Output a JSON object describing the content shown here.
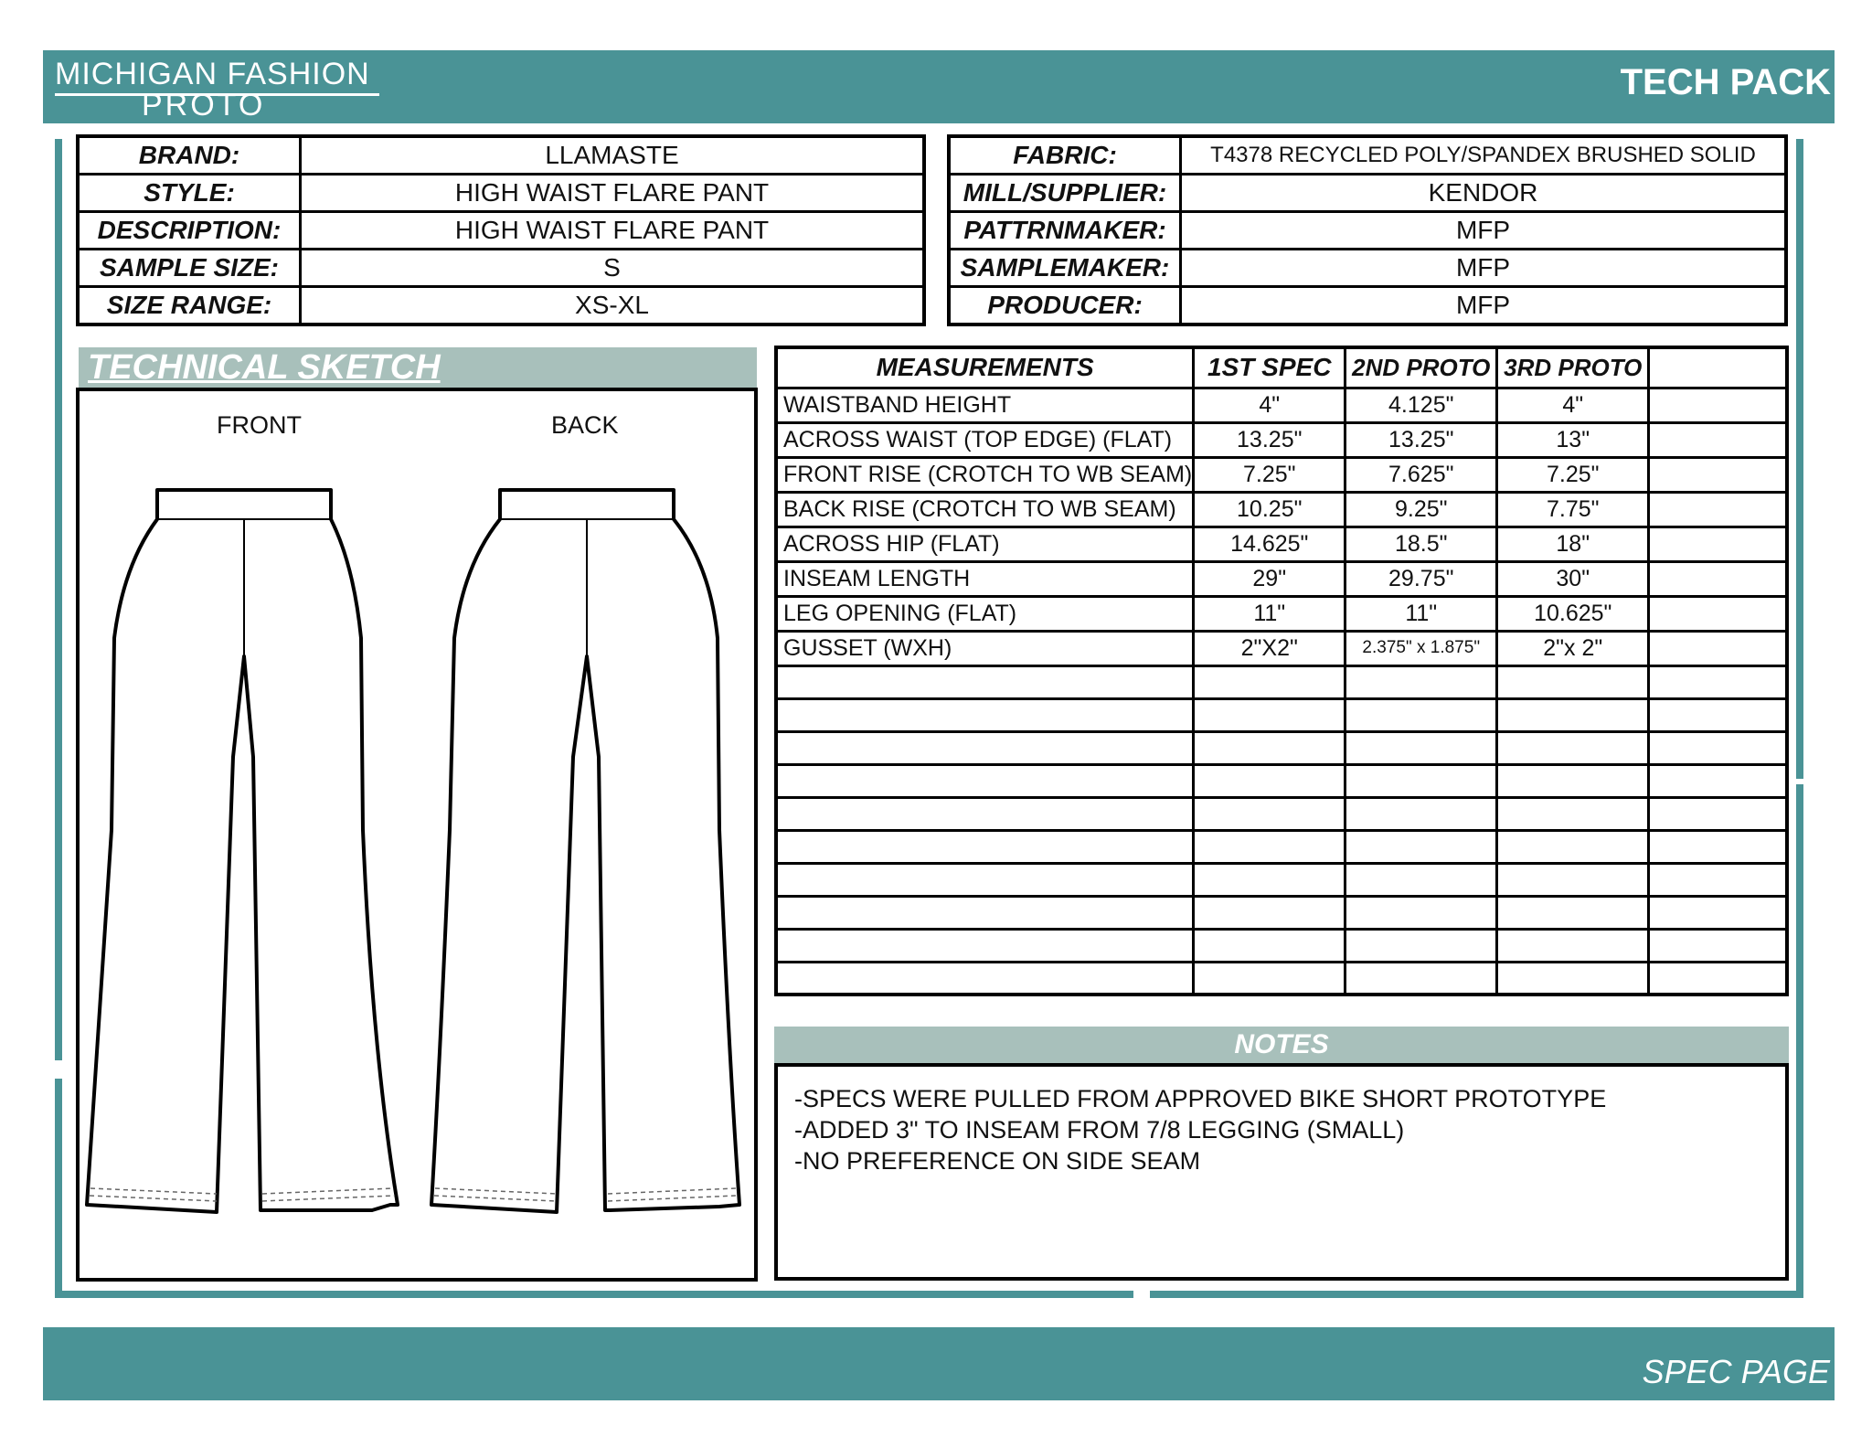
{
  "header": {
    "logo_line1": "MICHIGAN FASHION",
    "logo_line2": "PROTO",
    "title": "TECH PACK"
  },
  "footer": {
    "label": "SPEC PAGE"
  },
  "info_left": [
    {
      "label": "BRAND:",
      "value": "LLAMASTE"
    },
    {
      "label": "STYLE:",
      "value": "HIGH WAIST FLARE PANT"
    },
    {
      "label": "DESCRIPTION:",
      "value": "HIGH WAIST FLARE PANT"
    },
    {
      "label": "SAMPLE SIZE:",
      "value": "S"
    },
    {
      "label": "SIZE RANGE:",
      "value": "XS-XL"
    }
  ],
  "info_right": [
    {
      "label": "FABRIC:",
      "value": "T4378 RECYCLED POLY/SPANDEX BRUSHED SOLID"
    },
    {
      "label": "MILL/SUPPLIER:",
      "value": "KENDOR"
    },
    {
      "label": "PATTRNMAKER:",
      "value": "MFP"
    },
    {
      "label": "SAMPLEMAKER:",
      "value": "MFP"
    },
    {
      "label": "PRODUCER:",
      "value": "MFP"
    }
  ],
  "sketch": {
    "title": "TECHNICAL SKETCH",
    "front_label": "FRONT",
    "back_label": "BACK"
  },
  "measurements": {
    "headers": [
      "MEASUREMENTS",
      "1ST SPEC",
      "2ND PROTO",
      "3RD PROTO",
      ""
    ],
    "rows": [
      [
        "WAISTBAND HEIGHT",
        "4\"",
        "4.125\"",
        "4\"",
        ""
      ],
      [
        "ACROSS WAIST (TOP EDGE) (FLAT)",
        "13.25\"",
        "13.25\"",
        "13\"",
        ""
      ],
      [
        "FRONT RISE (CROTCH TO WB SEAM)",
        "7.25\"",
        "7.625\"",
        "7.25\"",
        ""
      ],
      [
        "BACK RISE (CROTCH TO WB SEAM)",
        "10.25\"",
        "9.25\"",
        "7.75\"",
        ""
      ],
      [
        "ACROSS HIP (FLAT)",
        "14.625\"",
        "18.5\"",
        "18\"",
        ""
      ],
      [
        "INSEAM LENGTH",
        "29\"",
        "29.75\"",
        "30\"",
        ""
      ],
      [
        "LEG OPENING (FLAT)",
        "11\"",
        "11\"",
        "10.625\"",
        ""
      ],
      [
        "GUSSET (WXH)",
        "2\"X2\"",
        "2.375\" x 1.875\"",
        "2\"x 2\"",
        ""
      ],
      [
        "",
        "",
        "",
        "",
        ""
      ],
      [
        "",
        "",
        "",
        "",
        ""
      ],
      [
        "",
        "",
        "",
        "",
        ""
      ],
      [
        "",
        "",
        "",
        "",
        ""
      ],
      [
        "",
        "",
        "",
        "",
        ""
      ],
      [
        "",
        "",
        "",
        "",
        ""
      ],
      [
        "",
        "",
        "",
        "",
        ""
      ],
      [
        "",
        "",
        "",
        "",
        ""
      ],
      [
        "",
        "",
        "",
        "",
        ""
      ],
      [
        "",
        "",
        "",
        "",
        ""
      ]
    ]
  },
  "notes": {
    "title": "NOTES",
    "lines": [
      "-SPECS WERE PULLED FROM APPROVED BIKE SHORT PROTOTYPE",
      "-ADDED 3\"  TO INSEAM FROM 7/8 LEGGING (SMALL)",
      "-NO PREFERENCE ON SIDE SEAM"
    ]
  },
  "colors": {
    "teal": "#4a9396",
    "sage": "#a8c0bb"
  }
}
